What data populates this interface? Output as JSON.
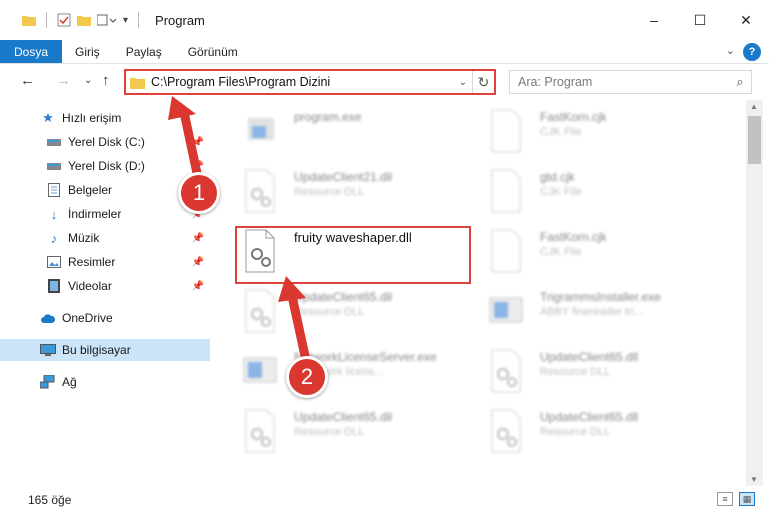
{
  "window": {
    "title": "Program",
    "controls": [
      "–",
      "☐",
      "✕"
    ]
  },
  "ribbon": {
    "tabs": [
      "Dosya",
      "Giriş",
      "Paylaş",
      "Görünüm"
    ],
    "active_tab": "Dosya"
  },
  "navbar": {
    "address": "C:\\Program Files\\Program Dizini",
    "search_placeholder": "Ara: Program"
  },
  "sidebar": {
    "items": [
      {
        "label": "Hızlı erişim",
        "icon": "star-icon"
      },
      {
        "label": "Yerel Disk (C:)",
        "icon": "drive-icon",
        "pinned": true
      },
      {
        "label": "Yerel Disk (D:)",
        "icon": "drive-icon",
        "pinned": true
      },
      {
        "label": "Belgeler",
        "icon": "document-icon",
        "pinned": true
      },
      {
        "label": "İndirmeler",
        "icon": "download-icon",
        "pinned": true
      },
      {
        "label": "Müzik",
        "icon": "music-icon",
        "pinned": true
      },
      {
        "label": "Resimler",
        "icon": "picture-icon",
        "pinned": true
      },
      {
        "label": "Videolar",
        "icon": "video-icon",
        "pinned": true
      },
      {
        "label": "OneDrive",
        "icon": "cloud-icon"
      },
      {
        "label": "Bu bilgisayar",
        "icon": "computer-icon",
        "selected": true
      },
      {
        "label": "Ağ",
        "icon": "network-icon"
      }
    ]
  },
  "files": [
    {
      "name": "program.exe",
      "type": ""
    },
    {
      "name": "FastKorn.cjk",
      "type": "CJK File"
    },
    {
      "name": "UpdateClient21.dll",
      "type": "Resource DLL"
    },
    {
      "name": "gtd.cjk",
      "type": "CJK File"
    },
    {
      "name": "fruity waveshaper.dll",
      "type": ""
    },
    {
      "name": "FastKorn.cjk",
      "type": "CJK File"
    },
    {
      "name": "UpdateClient65.dll",
      "type": "Resource DLL"
    },
    {
      "name": "TrigrammsInstaller.exe",
      "type": "ABBY finereader tri..."
    },
    {
      "name": "NetworkLicenseServer.exe",
      "type": "Y network licens..."
    },
    {
      "name": "UpdateClient65.dll",
      "type": "Resource DLL"
    },
    {
      "name": "UpdateClient65.dll",
      "type": "Resource DLL"
    },
    {
      "name": "UpdateClient65.dll",
      "type": "Resource DLL"
    }
  ],
  "status": {
    "count": "165 öğe"
  },
  "annotations": {
    "badge1": "1",
    "badge2": "2"
  },
  "colors": {
    "accent": "#1979ca",
    "highlight": "#e0413d",
    "selected_bg": "#cce4f7"
  }
}
